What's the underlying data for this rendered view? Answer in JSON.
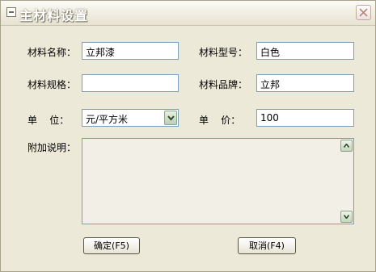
{
  "window": {
    "title": "主材料设置"
  },
  "form": {
    "material_name_label": "材料名称：",
    "material_name_value": "立邦漆",
    "material_model_label": "材料型号：",
    "material_model_value": "白色",
    "material_spec_label": "材料规格：",
    "material_spec_value": "",
    "material_brand_label": "材料品牌：",
    "material_brand_value": "立邦",
    "unit_label": "单    位：",
    "unit_value": "元/平方米",
    "price_label": "单    价：",
    "price_value": "100",
    "notes_label": "附加说明：",
    "notes_value": ""
  },
  "buttons": {
    "ok_label": "确定(F5)",
    "cancel_label": "取消(F4)"
  },
  "icons": {
    "window_menu": "system-menu-icon",
    "close": "close-icon",
    "dropdown": "chevron-down-icon",
    "scroll_up": "scroll-up-icon",
    "scroll_down": "scroll-down-icon"
  }
}
